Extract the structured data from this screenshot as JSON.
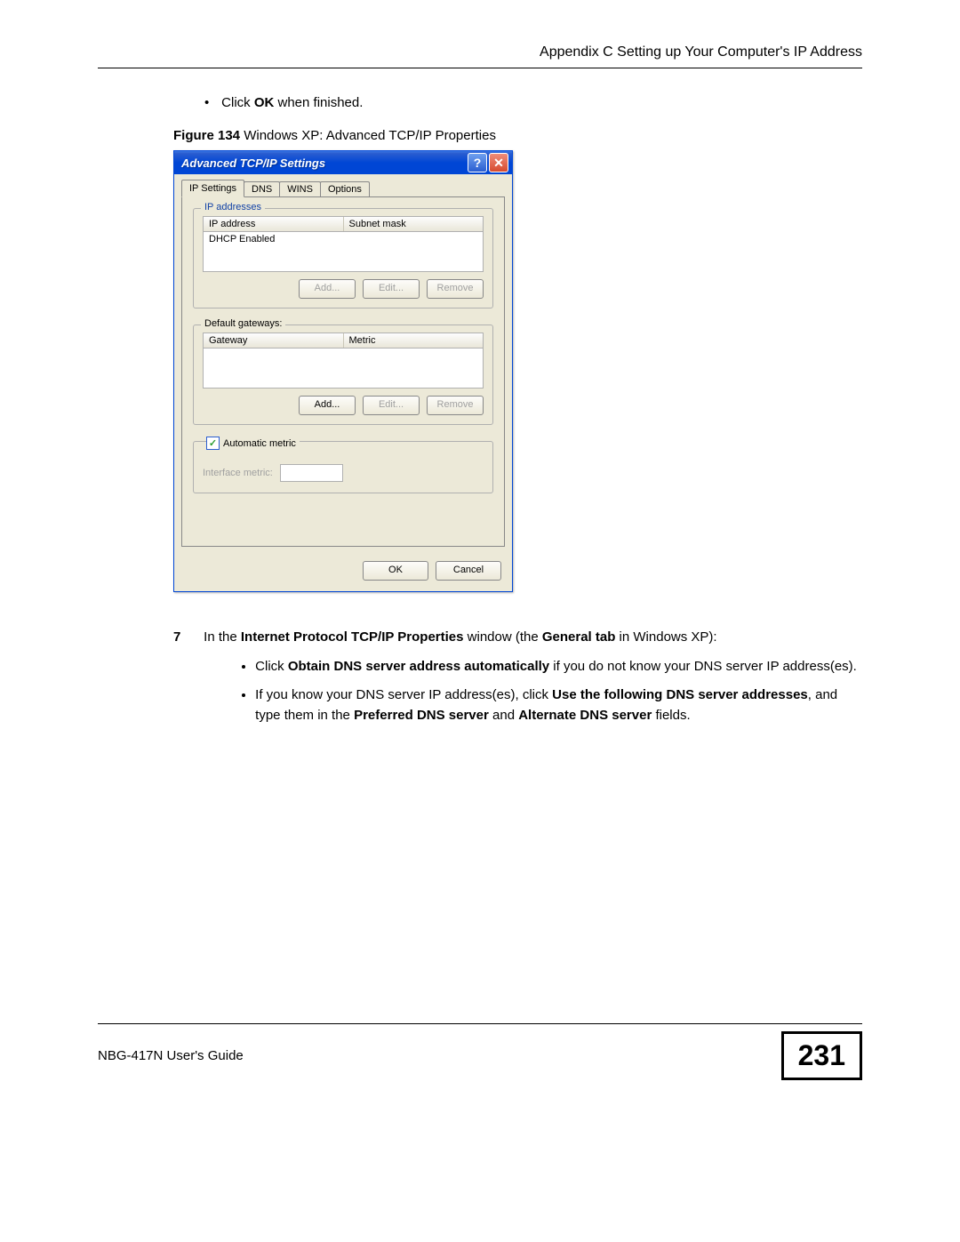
{
  "header": {
    "appendix_text": "Appendix C Setting up Your Computer's IP Address"
  },
  "intro_bullet": {
    "pre": "Click ",
    "bold": "OK",
    "post": " when finished."
  },
  "figure": {
    "label_bold": "Figure 134",
    "label_rest": "   Windows XP: Advanced TCP/IP Properties"
  },
  "dialog": {
    "title": "Advanced TCP/IP Settings",
    "tabs": [
      "IP Settings",
      "DNS",
      "WINS",
      "Options"
    ],
    "active_tab_index": 0,
    "ip_group": {
      "legend": "IP addresses",
      "col1": "IP address",
      "col2": "Subnet mask",
      "row1": "DHCP Enabled",
      "btn_add": "Add...",
      "btn_edit": "Edit...",
      "btn_remove": "Remove"
    },
    "gw_group": {
      "legend": "Default gateways:",
      "col1": "Gateway",
      "col2": "Metric",
      "btn_add": "Add...",
      "btn_edit": "Edit...",
      "btn_remove": "Remove"
    },
    "metric_group": {
      "legend": "",
      "chk_label": "Automatic metric",
      "metric_label": "Interface metric:"
    },
    "footer": {
      "ok": "OK",
      "cancel": "Cancel"
    }
  },
  "step7": {
    "num": "7",
    "pre": "In the ",
    "b1": "Internet Protocol TCP/IP Properties",
    "mid": " window (the ",
    "b2": "General tab",
    "post": " in Windows XP):",
    "bullet1": {
      "pre": "Click ",
      "b": "Obtain DNS server address automatically",
      "post": " if you do not know your DNS server IP address(es)."
    },
    "bullet2": {
      "pre": "If you know your DNS server IP address(es), click ",
      "b1": "Use the following DNS server addresses",
      "mid1": ", and type them in the ",
      "b2": "Preferred DNS server",
      "mid2": " and ",
      "b3": "Alternate DNS server",
      "post": " fields."
    }
  },
  "footer": {
    "guide": "NBG-417N User's Guide",
    "page": "231"
  }
}
